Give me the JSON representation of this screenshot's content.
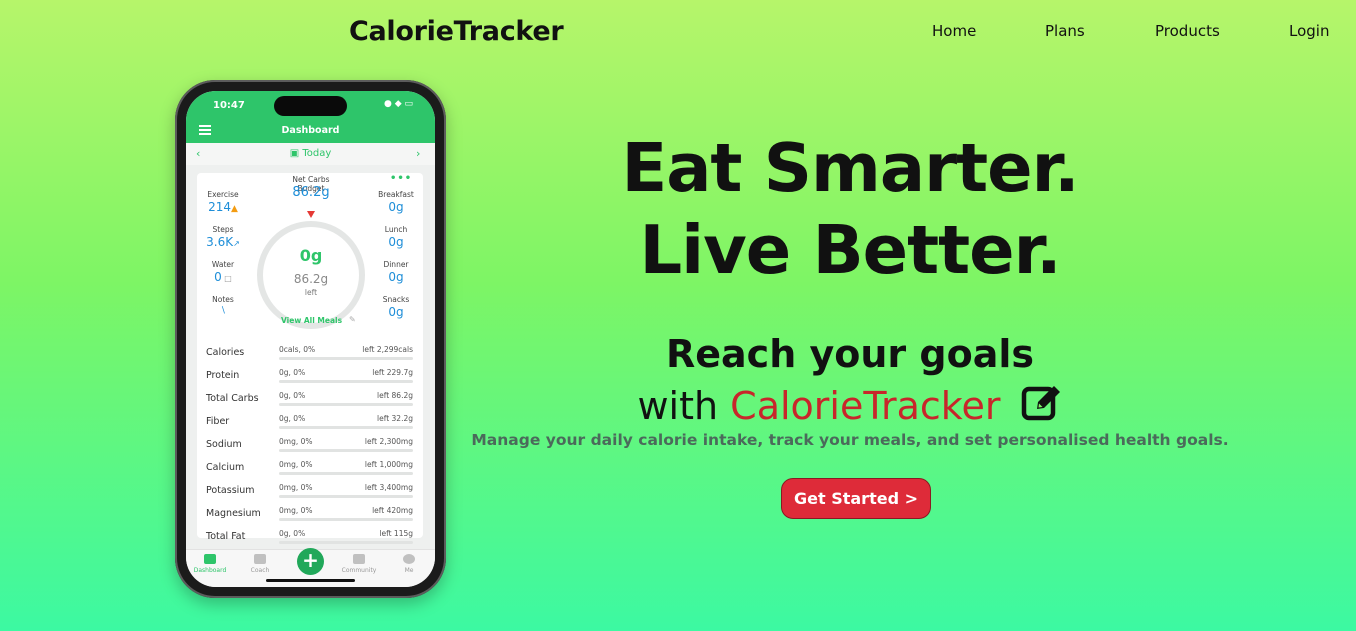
{
  "header": {
    "brand": "CalorieTracker",
    "nav": [
      "Home",
      "Plans",
      "Products",
      "Login"
    ]
  },
  "hero": {
    "title_line1": "Eat Smarter.",
    "title_line2": "Live Better.",
    "goal_line1": "Reach your goals",
    "goal_with": "with",
    "goal_brand": "CalorieTracker",
    "subtext": "Manage your daily calorie intake, track your meals, and set personalised health goals.",
    "cta": "Get Started >"
  },
  "phone": {
    "time": "10:47",
    "status_icons": "● ◆ ▭",
    "title": "Dashboard",
    "date_label": "Today",
    "budget_label": "Net Carbs Budget",
    "budget_value": "86.2g",
    "exercise_label": "Exercise",
    "exercise_value": "214",
    "steps_label": "Steps",
    "steps_value": "3.6K",
    "water_label": "Water",
    "water_value": "0",
    "notes_label": "Notes",
    "ring_main": "0g",
    "ring_left_value": "86.2g",
    "ring_left_label": "left",
    "breakfast_label": "Breakfast",
    "breakfast_value": "0g",
    "lunch_label": "Lunch",
    "lunch_value": "0g",
    "dinner_label": "Dinner",
    "dinner_value": "0g",
    "snacks_label": "Snacks",
    "snacks_value": "0g",
    "view_all": "View All Meals",
    "nutrients": [
      {
        "name": "Calories",
        "used": "0cals, 0%",
        "left": "left 2,299cals"
      },
      {
        "name": "Protein",
        "used": "0g, 0%",
        "left": "left 229.7g"
      },
      {
        "name": "Total Carbs",
        "used": "0g, 0%",
        "left": "left 86.2g"
      },
      {
        "name": "Fiber",
        "used": "0g, 0%",
        "left": "left 32.2g"
      },
      {
        "name": "Sodium",
        "used": "0mg, 0%",
        "left": "left 2,300mg"
      },
      {
        "name": "Calcium",
        "used": "0mg, 0%",
        "left": "left 1,000mg"
      },
      {
        "name": "Potassium",
        "used": "0mg, 0%",
        "left": "left 3,400mg"
      },
      {
        "name": "Magnesium",
        "used": "0mg, 0%",
        "left": "left 420mg"
      },
      {
        "name": "Total Fat",
        "used": "0g, 0%",
        "left": "left 115g"
      }
    ],
    "tabs": [
      "Dashboard",
      "Coach",
      "Community",
      "Me"
    ]
  },
  "colors": {
    "accent_green": "#2ec56a",
    "cta_red": "#de2b39",
    "brand_red": "#c8262b"
  }
}
